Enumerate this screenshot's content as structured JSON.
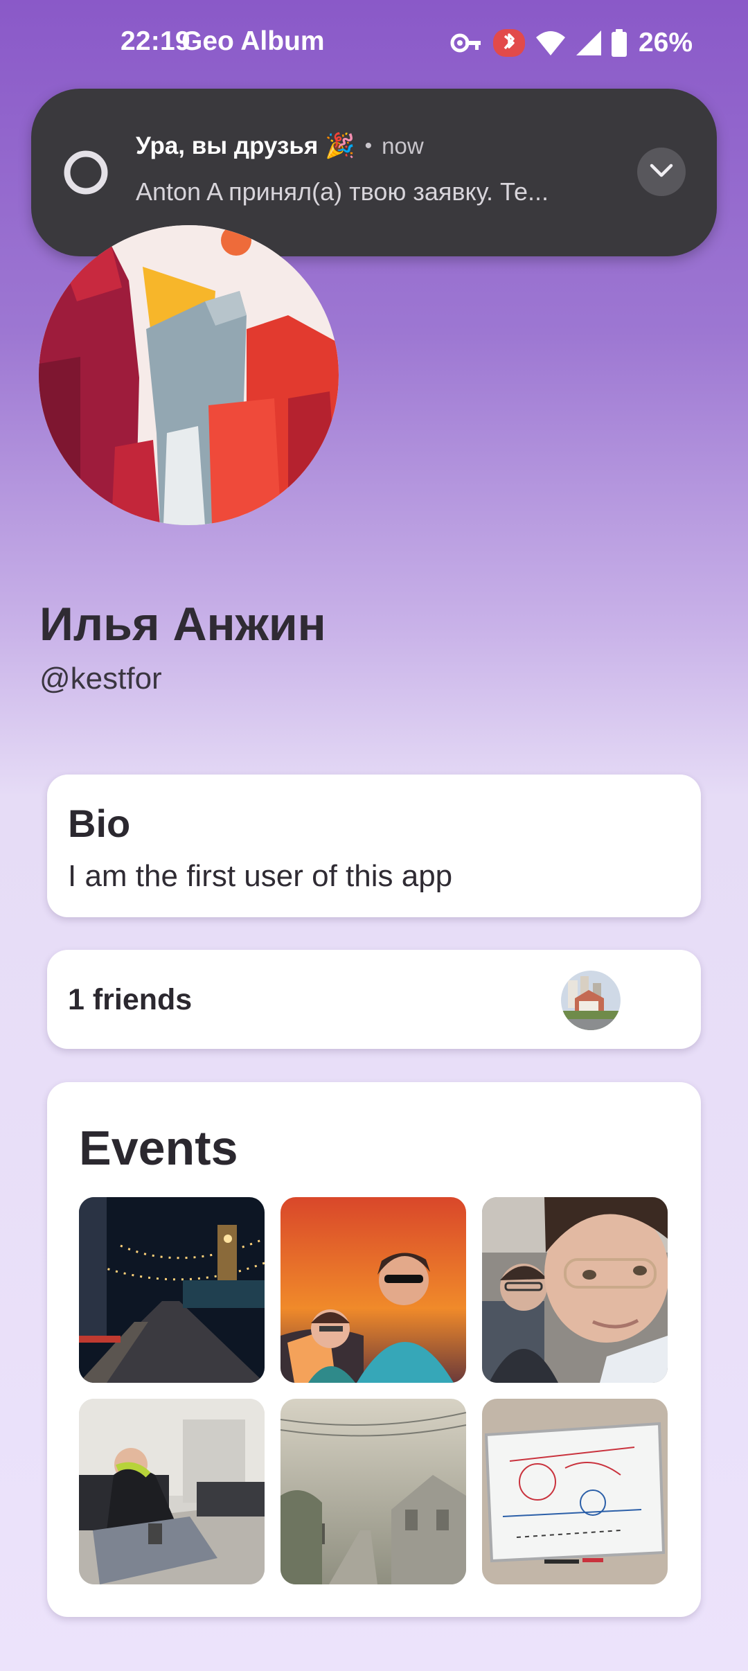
{
  "status_bar": {
    "time": "22:19",
    "app_name": "Geo Album",
    "battery": "26%",
    "icons": [
      "vpn-key-icon",
      "bluetooth-icon",
      "wifi-icon",
      "cellular-signal-icon",
      "battery-icon"
    ]
  },
  "notification": {
    "title": "Ура, вы друзья 🎉",
    "time": "now",
    "body": "Anton A принял(а) твою заявку. Те...",
    "icon": "ring-icon",
    "expand_icon": "chevron-down-icon"
  },
  "profile": {
    "name": "Илья Анжин",
    "handle": "@kestfor"
  },
  "bio": {
    "title": "Bio",
    "text": "I am the first user of this app"
  },
  "friends": {
    "label": "1 friends"
  },
  "events": {
    "title": "Events",
    "photos": [
      "night-street-photo",
      "sunset-selfie-photo",
      "airplane-selfie-photo",
      "airport-lounge-photo",
      "foggy-road-photo",
      "whiteboard-photo"
    ]
  },
  "colors": {
    "header_purple": "#8a59c8",
    "background_lavender": "#ece3fb",
    "notification_bg": "#3a393d",
    "card_bg": "#ffffff"
  }
}
